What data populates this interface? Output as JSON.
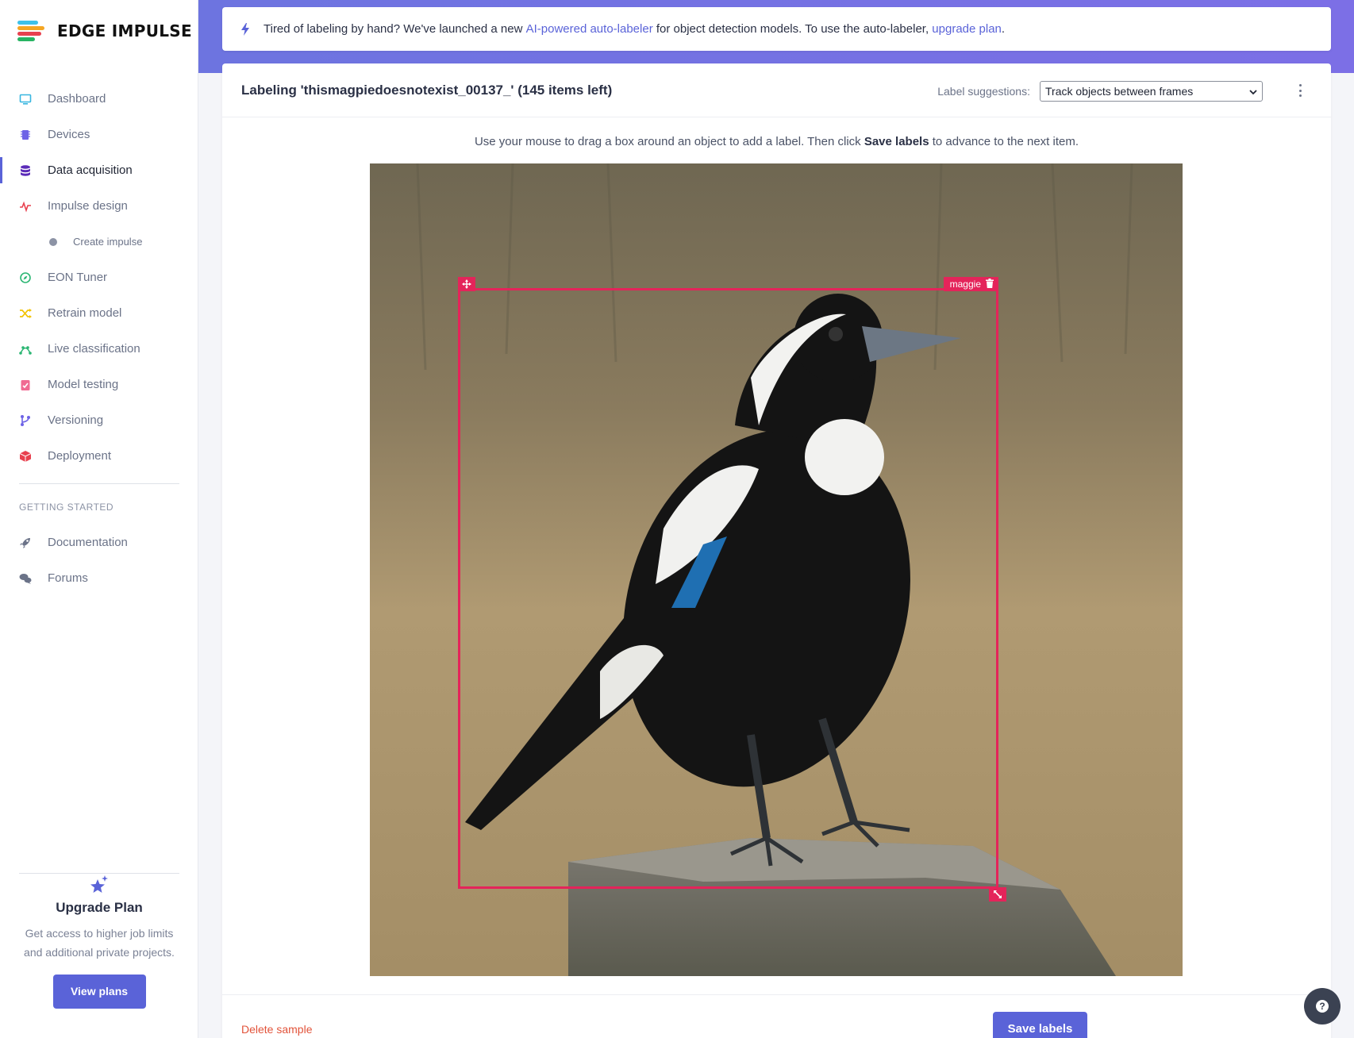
{
  "app": {
    "brand": "EDGE IMPULSE",
    "logo_colors": [
      "#3ec1e9",
      "#f5a623",
      "#e8414f",
      "#28b463"
    ]
  },
  "sidebar": {
    "items": [
      {
        "label": "Dashboard",
        "icon": "monitor-icon",
        "color": "#38b6e0"
      },
      {
        "label": "Devices",
        "icon": "chip-icon",
        "color": "#6e63e6"
      },
      {
        "label": "Data acquisition",
        "icon": "database-icon",
        "color": "#5b2bb8",
        "active": true
      },
      {
        "label": "Impulse design",
        "icon": "pulse-icon",
        "color": "#e8414f"
      }
    ],
    "sub_items": [
      {
        "label": "Create impulse"
      }
    ],
    "items_after": [
      {
        "label": "EON Tuner",
        "icon": "compass-icon",
        "color": "#2bb673"
      },
      {
        "label": "Retrain model",
        "icon": "shuffle-icon",
        "color": "#f2c200"
      },
      {
        "label": "Live classification",
        "icon": "network-icon",
        "color": "#2bb673"
      },
      {
        "label": "Model testing",
        "icon": "clipboard-check-icon",
        "color": "#f06a92"
      },
      {
        "label": "Versioning",
        "icon": "branch-icon",
        "color": "#6e63e6"
      },
      {
        "label": "Deployment",
        "icon": "box-icon",
        "color": "#e8414f"
      }
    ],
    "section_title": "GETTING STARTED",
    "getting_started": [
      {
        "label": "Documentation",
        "icon": "rocket-icon"
      },
      {
        "label": "Forums",
        "icon": "chat-icon"
      }
    ],
    "upgrade": {
      "title": "Upgrade Plan",
      "text": "Get access to higher job limits and additional private projects.",
      "button": "View plans"
    }
  },
  "banner": {
    "text_before": "Tired of labeling by hand? We've launched a new ",
    "link1": "AI-powered auto-labeler",
    "text_middle": " for object detection models. To use the auto-labeler, ",
    "link2": "upgrade plan",
    "text_after": "."
  },
  "labeling": {
    "title": "Labeling 'thismagpiedoesnotexist_00137_' (145 items left)",
    "suggestions_label": "Label suggestions:",
    "suggestions_value": "Track objects between frames",
    "instruction_before": "Use your mouse to drag a box around an object to add a label. Then click ",
    "instruction_bold": "Save labels",
    "instruction_after": " to advance to the next item.",
    "box_label": "maggie",
    "delete_sample": "Delete sample",
    "save_labels": "Save labels"
  },
  "colors": {
    "accent": "#5a63d8",
    "box": "#e4245a",
    "danger": "#e2533a"
  }
}
